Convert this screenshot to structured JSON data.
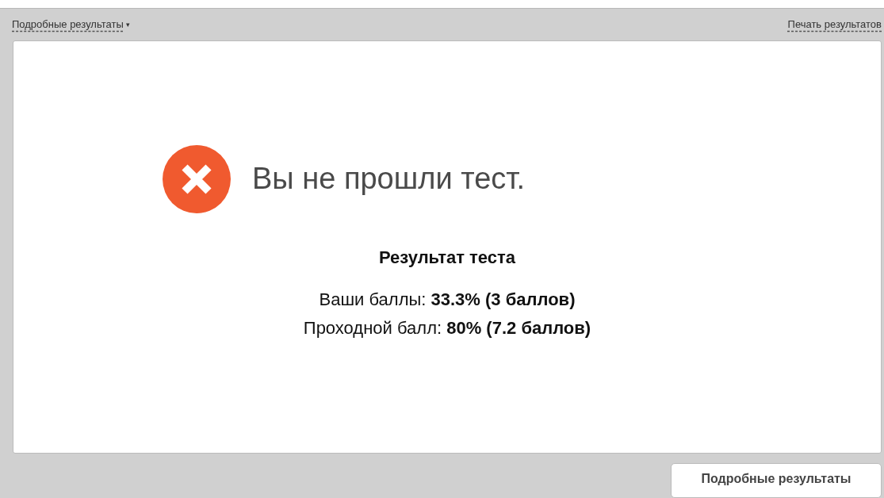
{
  "toolbar": {
    "details_link": {
      "label": "Подробные результаты",
      "caret": "▾"
    },
    "print_link": {
      "label": "Печать результатов"
    }
  },
  "result": {
    "passed": false,
    "headline": "Вы не прошли тест.",
    "title": "Результат теста",
    "lines": [
      "Ваши баллы: **33.3% (3 баллов)**",
      "Проходной балл: **80% (7.2 баллов)**"
    ]
  },
  "footer": {
    "button": "Подробные результаты"
  }
}
